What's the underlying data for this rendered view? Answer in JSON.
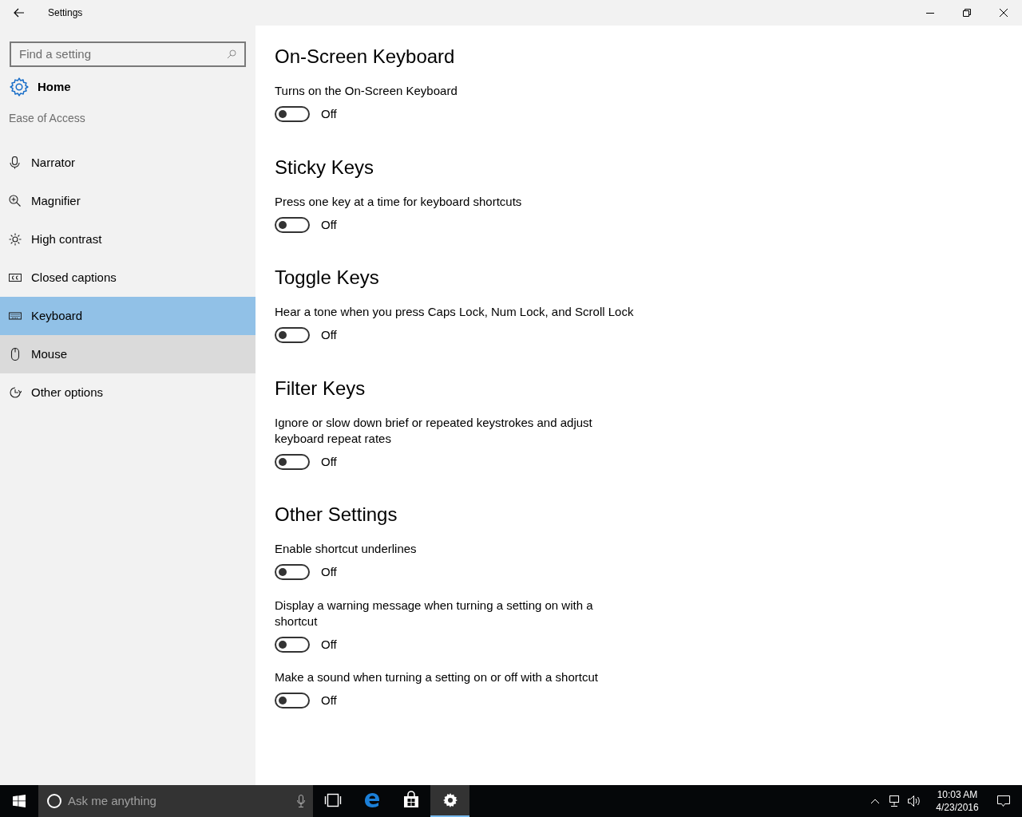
{
  "window": {
    "title": "Settings"
  },
  "sidebar": {
    "search": {
      "placeholder": "Find a setting"
    },
    "home": "Home",
    "category": "Ease of Access",
    "items": [
      {
        "label": "Narrator",
        "selected": false,
        "hovered": false
      },
      {
        "label": "Magnifier",
        "selected": false,
        "hovered": false
      },
      {
        "label": "High contrast",
        "selected": false,
        "hovered": false
      },
      {
        "label": "Closed captions",
        "selected": false,
        "hovered": false
      },
      {
        "label": "Keyboard",
        "selected": true,
        "hovered": false
      },
      {
        "label": "Mouse",
        "selected": false,
        "hovered": true
      },
      {
        "label": "Other options",
        "selected": false,
        "hovered": false
      }
    ]
  },
  "sections": [
    {
      "title": "On-Screen Keyboard",
      "settings": [
        {
          "description": "Turns on the On-Screen Keyboard",
          "on": false,
          "state_label": "Off"
        }
      ]
    },
    {
      "title": "Sticky Keys",
      "settings": [
        {
          "description": "Press one key at a time for keyboard shortcuts",
          "on": false,
          "state_label": "Off"
        }
      ]
    },
    {
      "title": "Toggle Keys",
      "settings": [
        {
          "description": "Hear a tone when you press Caps Lock, Num Lock, and Scroll Lock",
          "on": false,
          "state_label": "Off"
        }
      ]
    },
    {
      "title": "Filter Keys",
      "settings": [
        {
          "description": "Ignore or slow down brief or repeated keystrokes and adjust keyboard repeat rates",
          "on": false,
          "state_label": "Off"
        }
      ]
    },
    {
      "title": "Other Settings",
      "settings": [
        {
          "description": "Enable shortcut underlines",
          "on": false,
          "state_label": "Off"
        },
        {
          "description": "Display a warning message when turning a setting on with a shortcut",
          "on": false,
          "state_label": "Off"
        },
        {
          "description": "Make a sound when turning a setting on or off with a shortcut",
          "on": false,
          "state_label": "Off"
        }
      ]
    }
  ],
  "taskbar": {
    "search_placeholder": "Ask me anything",
    "apps": [
      {
        "selected": false
      },
      {
        "selected": false
      },
      {
        "selected": false
      },
      {
        "selected": true
      }
    ],
    "clock": {
      "time": "10:03 AM",
      "date": "4/23/2016"
    }
  }
}
